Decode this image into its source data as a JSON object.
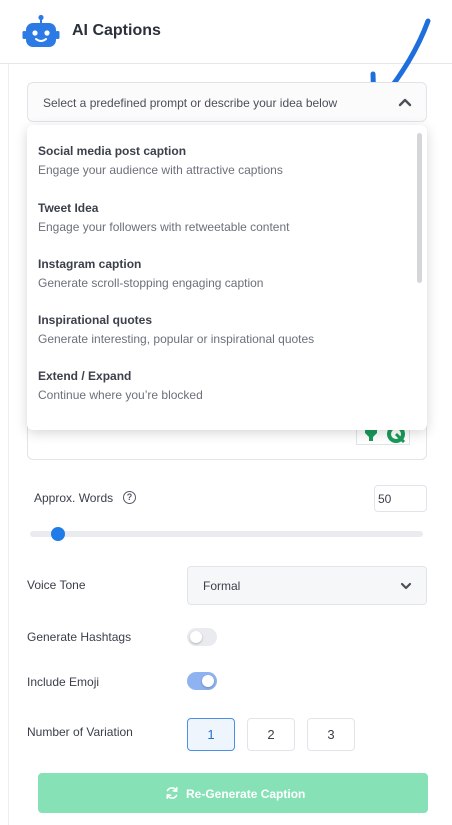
{
  "header": {
    "title": "AI Captions",
    "logo_icon": "robot-icon"
  },
  "prompt_select": {
    "placeholder": "Select a predefined prompt or describe your idea below"
  },
  "prompt_options": [
    {
      "title": "Social media post caption",
      "description": "Engage your audience with attractive captions"
    },
    {
      "title": "Tweet Idea",
      "description": "Engage your followers with retweetable content"
    },
    {
      "title": "Instagram caption",
      "description": "Generate scroll-stopping engaging caption"
    },
    {
      "title": "Inspirational quotes",
      "description": "Generate interesting, popular or inspirational quotes"
    },
    {
      "title": "Extend / Expand",
      "description": "Continue where you’re blocked"
    }
  ],
  "words": {
    "label": "Approx. Words",
    "value": "50",
    "help_icon": "help-circle-icon",
    "slider_fraction": 0.07
  },
  "tone": {
    "label": "Voice Tone",
    "value": "Formal"
  },
  "hashtags": {
    "label": "Generate Hashtags",
    "enabled": false
  },
  "emoji": {
    "label": "Include Emoji",
    "enabled": true
  },
  "variations": {
    "label": "Number of Variation",
    "options": [
      "1",
      "2",
      "3"
    ],
    "selected": "1"
  },
  "regenerate_button": {
    "label": "Re-Generate Caption",
    "icon": "refresh-icon"
  },
  "colors": {
    "accent_blue": "#1f7be8",
    "button_green": "#86e2b6",
    "robot_blue": "#2c7be5",
    "toggle_on": "#8fb3f0"
  }
}
